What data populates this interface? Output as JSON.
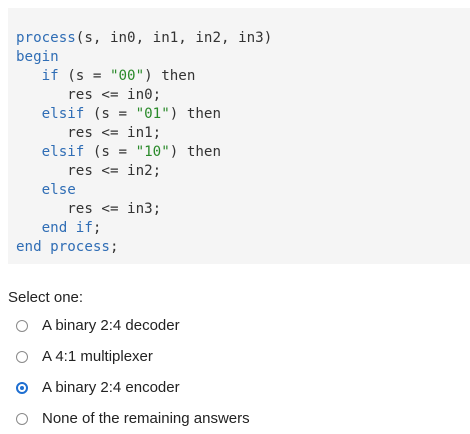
{
  "code": {
    "lines": [
      [
        {
          "t": "process",
          "c": "kw"
        },
        {
          "t": "(s, in0, in1, in2, in3)",
          "c": "ident"
        }
      ],
      [
        {
          "t": "begin",
          "c": "kw"
        }
      ],
      [
        {
          "t": "   ",
          "c": "ident"
        },
        {
          "t": "if",
          "c": "kw"
        },
        {
          "t": " (s = ",
          "c": "ident"
        },
        {
          "t": "\"00\"",
          "c": "str"
        },
        {
          "t": ") then",
          "c": "ident"
        }
      ],
      [
        {
          "t": "      res <= in0;",
          "c": "ident"
        }
      ],
      [
        {
          "t": "   ",
          "c": "ident"
        },
        {
          "t": "elsif",
          "c": "kw"
        },
        {
          "t": " (s = ",
          "c": "ident"
        },
        {
          "t": "\"01\"",
          "c": "str"
        },
        {
          "t": ") then",
          "c": "ident"
        }
      ],
      [
        {
          "t": "      res <= in1;",
          "c": "ident"
        }
      ],
      [
        {
          "t": "   ",
          "c": "ident"
        },
        {
          "t": "elsif",
          "c": "kw"
        },
        {
          "t": " (s = ",
          "c": "ident"
        },
        {
          "t": "\"10\"",
          "c": "str"
        },
        {
          "t": ") then",
          "c": "ident"
        }
      ],
      [
        {
          "t": "      res <= in2;",
          "c": "ident"
        }
      ],
      [
        {
          "t": "   ",
          "c": "ident"
        },
        {
          "t": "else",
          "c": "kw"
        }
      ],
      [
        {
          "t": "      res <= in3;",
          "c": "ident"
        }
      ],
      [
        {
          "t": "   ",
          "c": "ident"
        },
        {
          "t": "end if",
          "c": "kw"
        },
        {
          "t": ";",
          "c": "ident"
        }
      ],
      [
        {
          "t": "end process",
          "c": "kw"
        },
        {
          "t": ";",
          "c": "ident"
        }
      ]
    ]
  },
  "question": {
    "prompt": "Select one:",
    "options": [
      {
        "label": "A binary 2:4 decoder",
        "selected": false
      },
      {
        "label": "A 4:1 multiplexer",
        "selected": false
      },
      {
        "label": "A binary 2:4 encoder",
        "selected": true
      },
      {
        "label": "None of the remaining answers",
        "selected": false
      }
    ]
  },
  "colors": {
    "keyword": "#2f6db5",
    "string": "#2a8a2a",
    "text": "#333333",
    "code_background": "#f5f5f5",
    "radio_selected": "#1f6fd1"
  }
}
